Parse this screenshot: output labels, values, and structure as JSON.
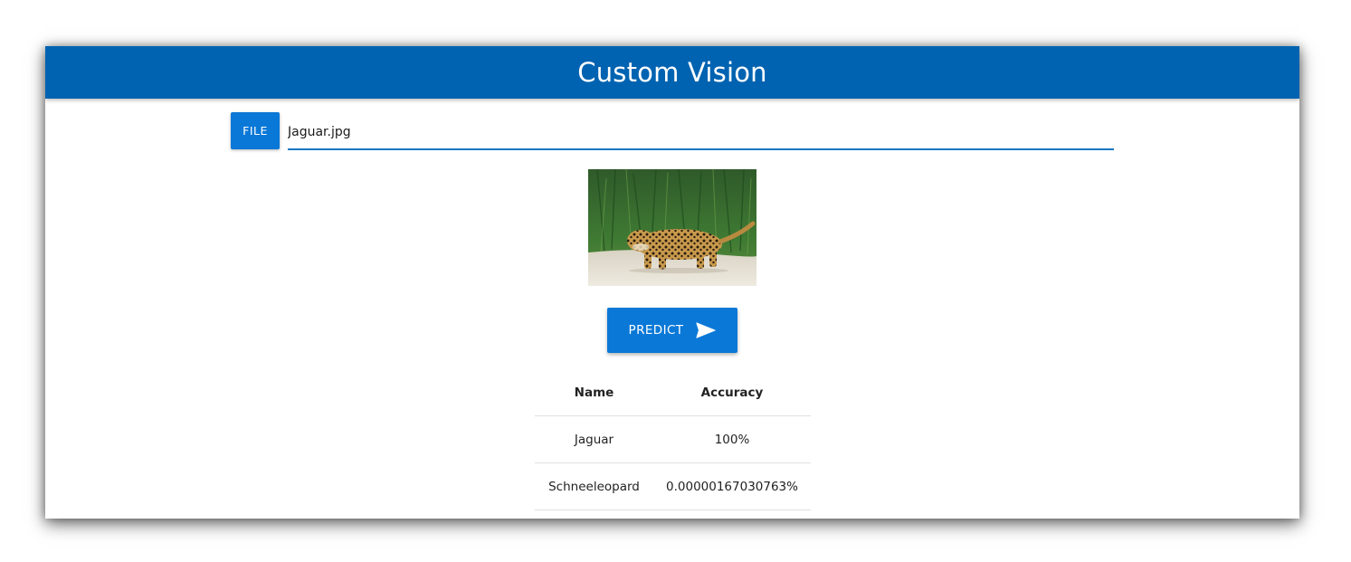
{
  "app": {
    "title": "Custom Vision"
  },
  "file_input": {
    "button_label": "FILE",
    "value": "Jaguar.jpg"
  },
  "preview": {
    "subject": "jaguar walking on sandy riverbank"
  },
  "predict_button": {
    "label": "PREDICT",
    "icon": "send-icon"
  },
  "results": {
    "headers": [
      "Name",
      "Accuracy"
    ],
    "rows": [
      {
        "name": "Jaguar",
        "accuracy": "100%"
      },
      {
        "name": "Schneeleopard",
        "accuracy": "0.00000167030763%"
      }
    ]
  },
  "colors": {
    "appbar": "#0063b1",
    "button": "#0a78d7",
    "underline": "#1a78c2"
  }
}
